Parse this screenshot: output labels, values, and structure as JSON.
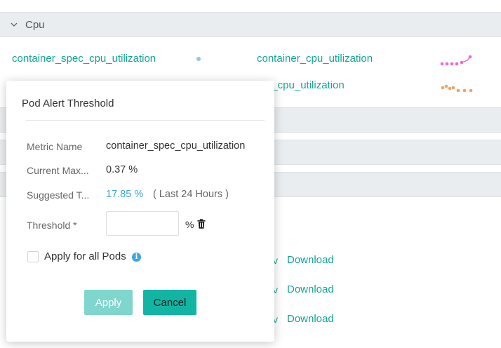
{
  "section": {
    "title": "Cpu"
  },
  "metrics": {
    "row1_left": "container_spec_cpu_utilization",
    "row1_right": "container_cpu_utilization",
    "row2_right_partial": "l_cpu_utilization"
  },
  "downloads": {
    "label": "Download",
    "v_mark": "v"
  },
  "colors": {
    "accent": "#12a594",
    "link_blue": "#3ba6e0",
    "spark_pink": "#e96ad6",
    "spark_orange": "#f2a066"
  },
  "modal": {
    "title": "Pod Alert Threshold",
    "metric_name_label": "Metric Name",
    "metric_name_value": "container_spec_cpu_utilization",
    "current_max_label": "Current Max...",
    "current_max_value": "0.37 %",
    "suggested_label": "Suggested T...",
    "suggested_value": "17.85 %",
    "suggested_note": "( Last 24 Hours )",
    "threshold_label": "Threshold *",
    "threshold_value": "",
    "threshold_unit": "%",
    "apply_all_label": "Apply for all Pods",
    "apply_button": "Apply",
    "cancel_button": "Cancel"
  }
}
